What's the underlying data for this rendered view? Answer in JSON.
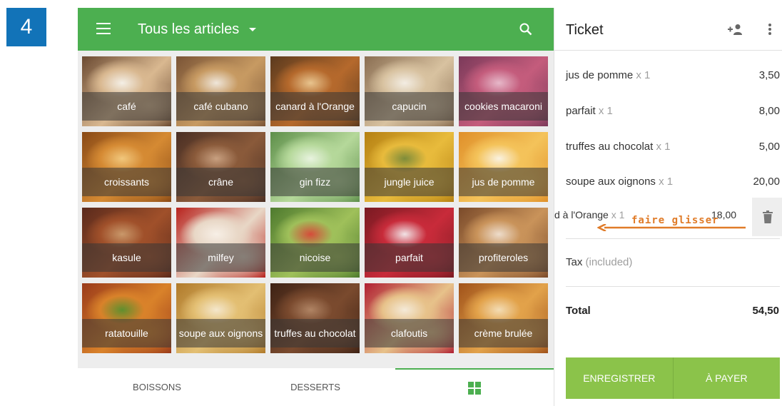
{
  "step": "4",
  "topbar": {
    "title": "Tous les articles",
    "menu_icon": "hamburger-icon",
    "search_icon": "search-icon"
  },
  "tiles": [
    {
      "label": "café",
      "palette": [
        "#6b4a32",
        "#d9b890",
        "#f4efe6"
      ]
    },
    {
      "label": "café cubano",
      "palette": [
        "#7a5436",
        "#c79a62",
        "#efe6da"
      ]
    },
    {
      "label": "canard à l'Orange",
      "palette": [
        "#5b3a1e",
        "#b5692c",
        "#e8c48e"
      ]
    },
    {
      "label": "capucin",
      "palette": [
        "#8a6e52",
        "#d8c2a0",
        "#f3ede3"
      ]
    },
    {
      "label": "cookies macaroni",
      "palette": [
        "#7b3a5a",
        "#c45c7c",
        "#e6b8c9"
      ]
    },
    {
      "label": "croissants",
      "palette": [
        "#8a4a16",
        "#d58a33",
        "#f1c77c"
      ]
    },
    {
      "label": "crâne",
      "palette": [
        "#4a2f24",
        "#8a5a3a",
        "#c8a080"
      ]
    },
    {
      "label": "gin fizz",
      "palette": [
        "#5e8f4a",
        "#b5d89a",
        "#e8f3df"
      ]
    },
    {
      "label": "jungle juice",
      "palette": [
        "#b58012",
        "#e8bb3c",
        "#7e8c3a"
      ]
    },
    {
      "label": "jus de pomme",
      "palette": [
        "#e0902a",
        "#f4c35a",
        "#faf2e0"
      ]
    },
    {
      "label": "kasule",
      "palette": [
        "#5a2a1c",
        "#a0502a",
        "#c9986a"
      ]
    },
    {
      "label": "milfey",
      "palette": [
        "#b8231e",
        "#e8d7c6",
        "#f7efe6"
      ]
    },
    {
      "label": "nicoise",
      "palette": [
        "#4e7a2e",
        "#9fc05a",
        "#d54c3a"
      ]
    },
    {
      "label": "parfait",
      "palette": [
        "#7a1a22",
        "#c82b3a",
        "#f1e3e6"
      ]
    },
    {
      "label": "profiteroles",
      "palette": [
        "#7a4a2a",
        "#c9935a",
        "#eddccb"
      ]
    },
    {
      "label": "ratatouille",
      "palette": [
        "#9a3a1a",
        "#d9822a",
        "#5f8f2e"
      ]
    },
    {
      "label": "soupe aux oignons",
      "palette": [
        "#b07a2a",
        "#e3bf73",
        "#f4e7cc"
      ]
    },
    {
      "label": "truffes au chocolat",
      "palette": [
        "#3e2215",
        "#7a4a2e",
        "#b08464"
      ]
    },
    {
      "label": "clafoutis",
      "palette": [
        "#b02032",
        "#e7c28a",
        "#f4ead8"
      ]
    },
    {
      "label": "crème brulée",
      "palette": [
        "#a0521a",
        "#e2a24a",
        "#f3dcb4"
      ]
    }
  ],
  "bottom_tabs": [
    {
      "label": "BOISSONS"
    },
    {
      "label": "DESSERTS"
    },
    {
      "label": "",
      "icon": "grid-icon"
    }
  ],
  "ticket": {
    "title": "Ticket",
    "add_customer_icon": "add-person-icon",
    "more_icon": "more-vert-icon",
    "lines": [
      {
        "name": "jus de pomme",
        "qty": "x 1",
        "price": "3,50"
      },
      {
        "name": "parfait",
        "qty": "x 1",
        "price": "8,00"
      },
      {
        "name": "truffes au chocolat",
        "qty": "x 1",
        "price": "5,00"
      },
      {
        "name": "soupe aux oignons",
        "qty": "x 1",
        "price": "20,00"
      }
    ],
    "swiped_line": {
      "name": "d à l'Orange",
      "qty": "x 1",
      "price": "18,00"
    },
    "swipe_hint": "faire glisser",
    "delete_icon": "trash-icon",
    "tax_label": "Tax",
    "tax_note": "(included)",
    "total_label": "Total",
    "total_value": "54,50",
    "save_button": "ENREGISTRER",
    "pay_button": "À PAYER"
  },
  "colors": {
    "accent": "#4caf50",
    "button": "#8bc34a",
    "badge": "#1273b8",
    "hint": "#e07b28"
  }
}
